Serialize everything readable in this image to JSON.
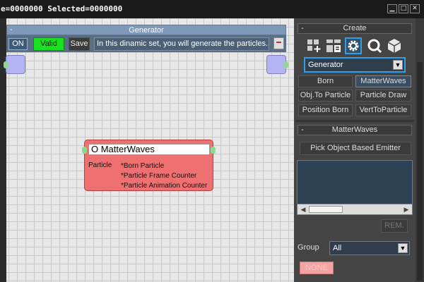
{
  "titlebar": {
    "text": "e=0000000  Selected=0000000",
    "min_glyph": "▁",
    "max_glyph": "□",
    "close_glyph": "✕"
  },
  "generator": {
    "collapse": "-",
    "title": "Generator",
    "on_label": "ON",
    "valid_label": "Valid",
    "save_label": "Save",
    "description": "In this dinamic set, you will generate the particles."
  },
  "node": {
    "title": "O MatterWaves",
    "type": "Particle",
    "items": [
      "*Born Particle",
      "*Particle Frame Counter",
      "*Particle Animation Counter"
    ]
  },
  "panel": {
    "create": {
      "collapse": "-",
      "title": "Create"
    },
    "tool_icons": [
      "create-icon",
      "modify-icon",
      "gear-icon",
      "wrench-icon",
      "cube-icon"
    ],
    "dropdown_value": "Generator",
    "dropdown_arrow": "▼",
    "modules": [
      "Born",
      "MatterWaves",
      "Obj.To Particle",
      "Particle Draw",
      "Position Born",
      "VertToParticle"
    ],
    "active_module": "MatterWaves",
    "matterwaves": {
      "collapse": "-",
      "title": "MatterWaves",
      "pick_button": "Pick Object Based Emitter",
      "rem_button": "REM.",
      "scroll_left": "◀",
      "scroll_right": "▶",
      "group_label": "Group",
      "group_value": "All",
      "group_arrow": "▼",
      "pink_button": "NONE"
    }
  },
  "colors": {
    "accent": "#2ea0e8",
    "valid": "#19e020",
    "node": "#ef7070",
    "port": "#b4b4f2"
  }
}
